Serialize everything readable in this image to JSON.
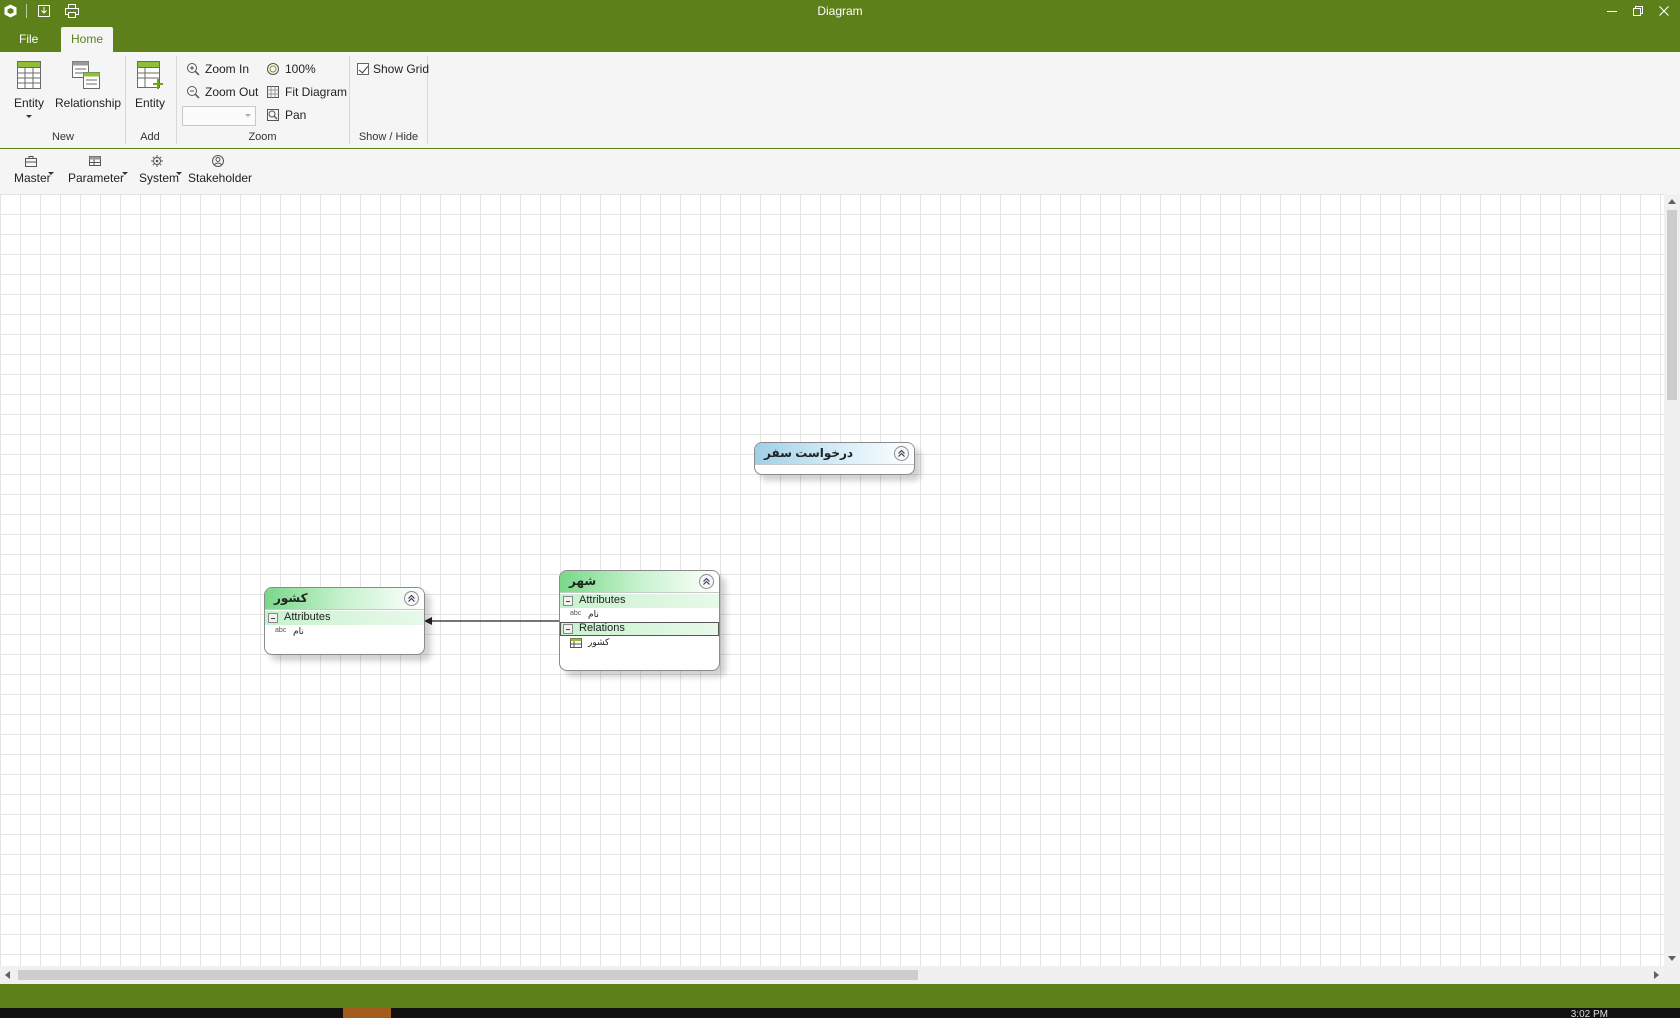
{
  "window": {
    "title": "Diagram"
  },
  "ribbon": {
    "tabs": [
      {
        "label": "File"
      },
      {
        "label": "Home"
      }
    ],
    "new_group": {
      "label": "New",
      "entity_label": "Entity",
      "relationship_label": "Relationship"
    },
    "add_group": {
      "label": "Add",
      "entity_label": "Entity"
    },
    "zoom_group": {
      "label": "Zoom",
      "zoom_in": "Zoom In",
      "zoom_out": "Zoom Out",
      "zoom_100": "100%",
      "fit_diagram": "Fit Diagram",
      "pan": "Pan",
      "zoom_value": ""
    },
    "showhide_group": {
      "label": "Show / Hide",
      "show_grid": "Show Grid",
      "show_grid_checked": true
    }
  },
  "toolbar2": {
    "items": [
      {
        "label": "Master"
      },
      {
        "label": "Parameter"
      },
      {
        "label": "System"
      },
      {
        "label": "Stakeholder"
      }
    ]
  },
  "diagram": {
    "entities": [
      {
        "id": "country",
        "name": "کشور",
        "color": "green",
        "sections": [
          {
            "label": "Attributes",
            "items": [
              {
                "icon": "abc",
                "text": "نام"
              }
            ]
          }
        ]
      },
      {
        "id": "city",
        "name": "شهر",
        "color": "green",
        "sections": [
          {
            "label": "Attributes",
            "items": [
              {
                "icon": "abc",
                "text": "نام"
              }
            ]
          },
          {
            "label": "Relations",
            "items": [
              {
                "icon": "table",
                "text": "کشور"
              }
            ]
          }
        ]
      },
      {
        "id": "travel-request",
        "name": "درخواست سفر",
        "color": "blue",
        "sections": []
      }
    ]
  },
  "colors": {
    "accent": "#5e801a",
    "entity_green": "#79d88a",
    "entity_blue": "#9ed0e8"
  },
  "taskbar": {
    "clock": "3:02 PM"
  }
}
